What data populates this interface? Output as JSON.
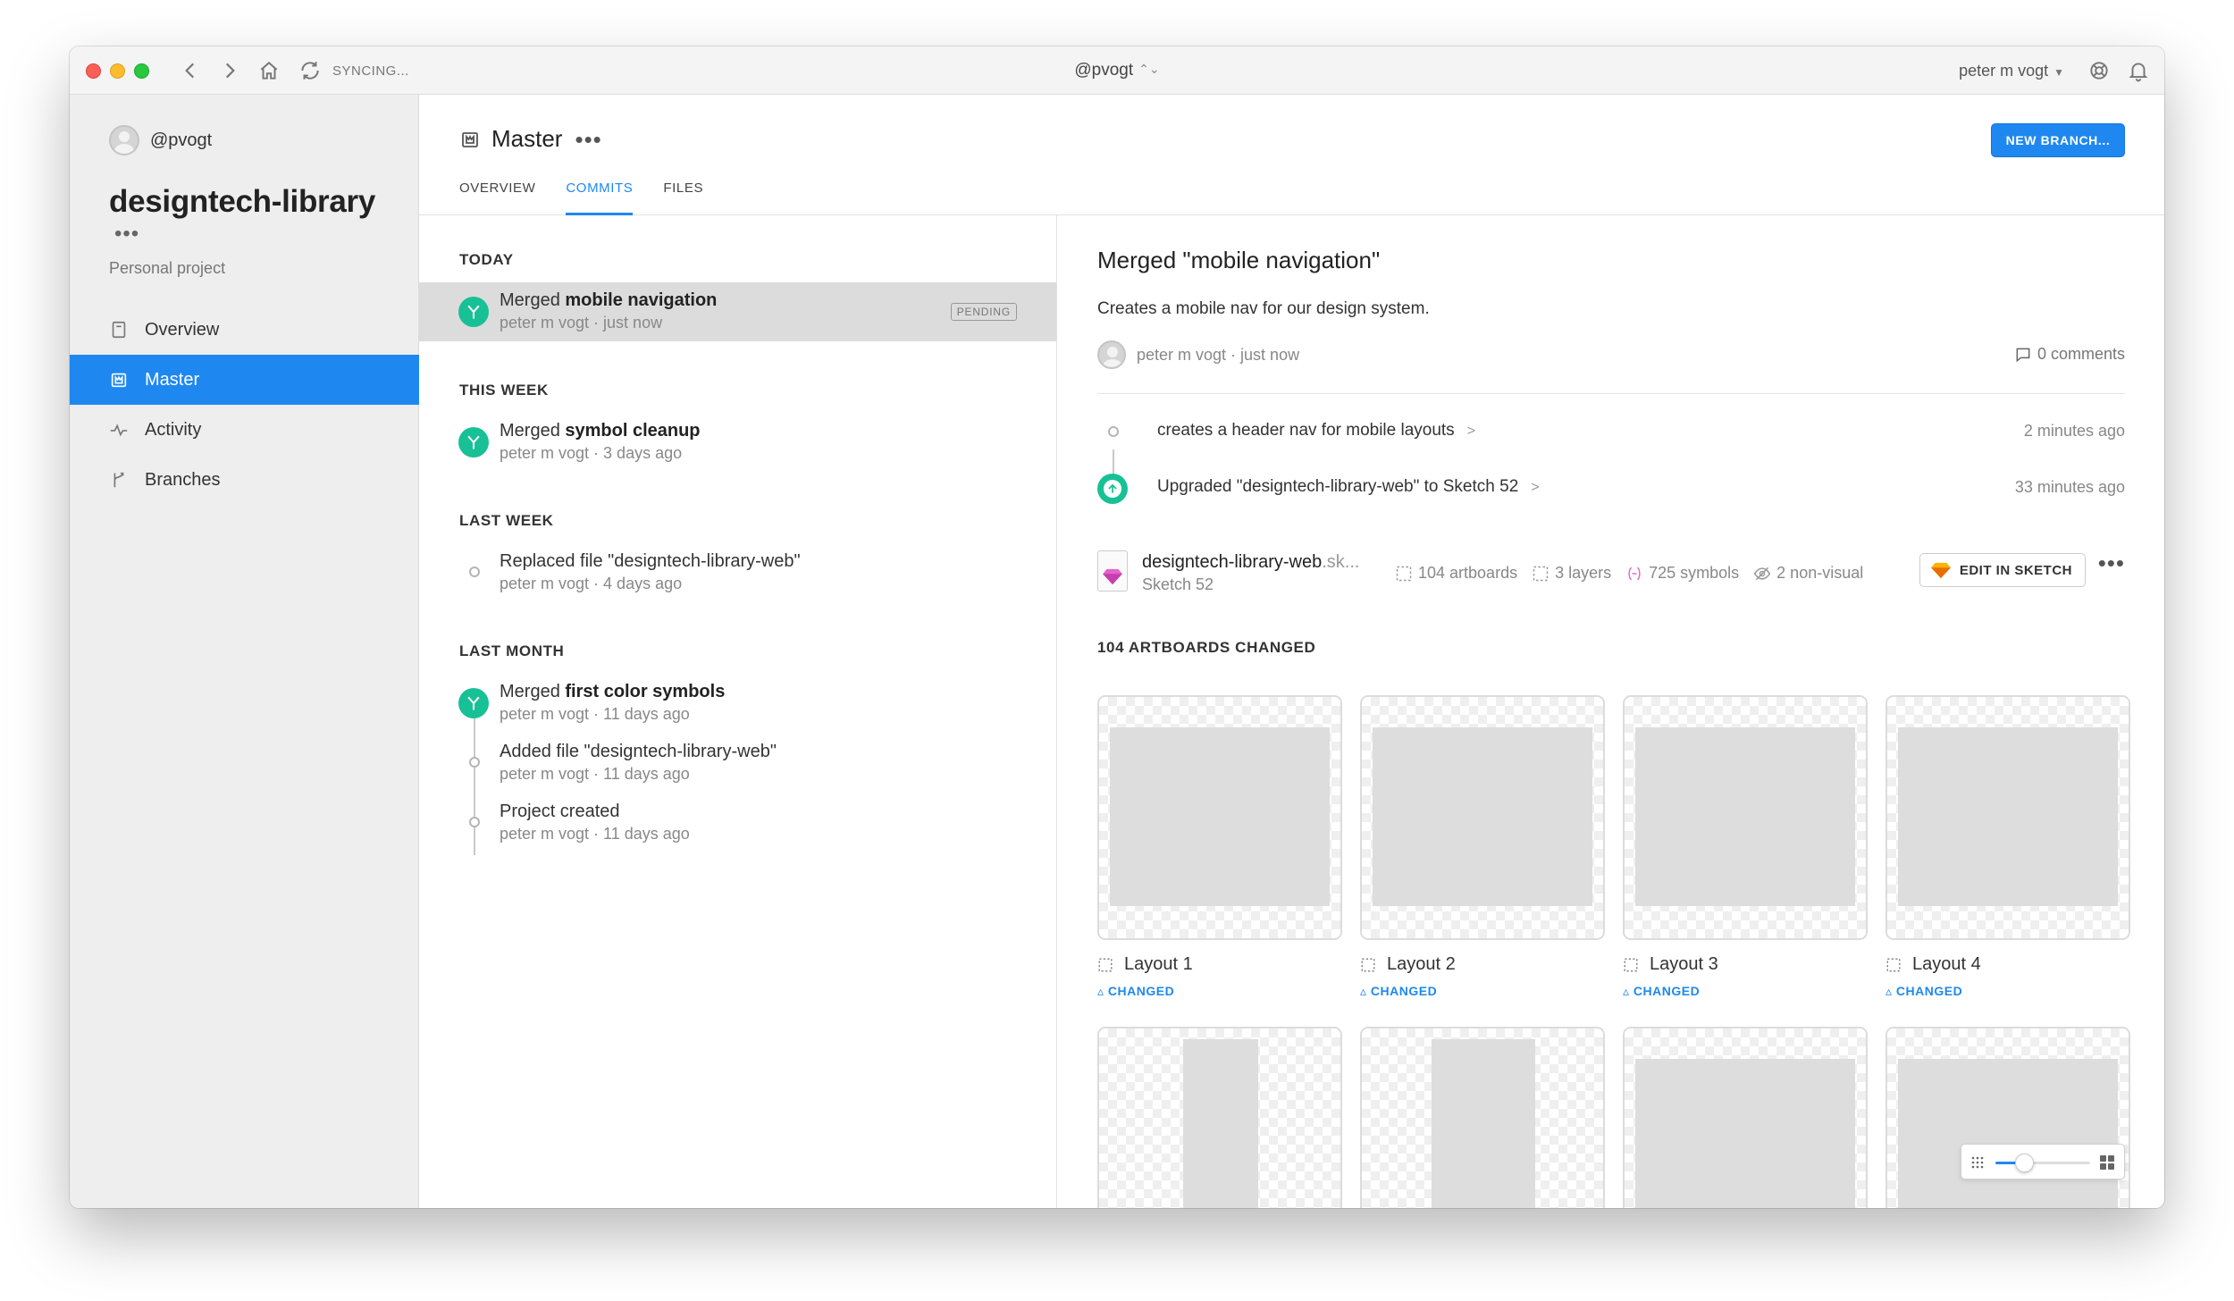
{
  "titlebar": {
    "sync_status": "SYNCING...",
    "workspace": "@pvogt",
    "user": "peter m vogt"
  },
  "sidebar": {
    "username": "@pvogt",
    "project_name": "designtech-library",
    "more": "•••",
    "project_type": "Personal project",
    "items": [
      {
        "label": "Overview",
        "icon": "document-icon"
      },
      {
        "label": "Master",
        "icon": "branch-crown-icon"
      },
      {
        "label": "Activity",
        "icon": "activity-icon"
      },
      {
        "label": "Branches",
        "icon": "branches-icon"
      }
    ],
    "active_index": 1
  },
  "header": {
    "title": "Master",
    "more": "•••",
    "new_branch": "NEW BRANCH...",
    "tabs": [
      "OVERVIEW",
      "COMMITS",
      "FILES"
    ],
    "active_tab": "COMMITS"
  },
  "commits": {
    "sections": [
      {
        "heading": "TODAY"
      },
      {
        "heading": "THIS WEEK"
      },
      {
        "heading": "LAST WEEK"
      },
      {
        "heading": "LAST MONTH"
      }
    ],
    "items": [
      {
        "prefix": "Merged ",
        "bold": "mobile navigation",
        "meta": "peter m vogt · just now",
        "badge": "PENDING",
        "type": "merge"
      },
      {
        "prefix": "Merged ",
        "bold": "symbol cleanup",
        "meta": "peter m vogt · 3 days ago",
        "type": "merge"
      },
      {
        "prefix": "Replaced file \"designtech-library-web\"",
        "bold": "",
        "meta": "peter m vogt · 4 days ago",
        "type": "node"
      },
      {
        "prefix": "Merged ",
        "bold": "first color symbols",
        "meta": "peter m vogt · 11 days ago",
        "type": "merge"
      },
      {
        "prefix": "Added file \"designtech-library-web\"",
        "bold": "",
        "meta": "peter m vogt · 11 days ago",
        "type": "node"
      },
      {
        "prefix": "Project created",
        "bold": "",
        "meta": "peter m vogt · 11 days ago",
        "type": "node"
      }
    ]
  },
  "detail": {
    "title": "Merged \"mobile navigation\"",
    "description": "Creates a mobile nav for our design system.",
    "author_meta": "peter m vogt · just now",
    "comments": "0 comments",
    "changes": [
      {
        "text": "creates a header nav for mobile layouts",
        "time": "2 minutes ago"
      },
      {
        "text": "Upgraded \"designtech-library-web\" to Sketch 52",
        "time": "33 minutes ago"
      }
    ],
    "file": {
      "name": "designtech-library-web",
      "ext": ".sk...",
      "version": "Sketch 52",
      "stats": [
        "104 artboards",
        "3 layers",
        "725 symbols",
        "2 non-visual"
      ],
      "edit_button": "EDIT IN SKETCH",
      "more": "•••"
    },
    "artboards_heading": "104 ARTBOARDS CHANGED",
    "artboards": [
      {
        "name": "Layout 1",
        "status": "CHANGED"
      },
      {
        "name": "Layout 2",
        "status": "CHANGED"
      },
      {
        "name": "Layout 3",
        "status": "CHANGED"
      },
      {
        "name": "Layout 4",
        "status": "CHANGED"
      }
    ],
    "zoom_level": 0.3
  },
  "colors": {
    "accent": "#1e88f0",
    "merge_green": "#18c095",
    "sidebar_bg": "#eeeeee"
  }
}
